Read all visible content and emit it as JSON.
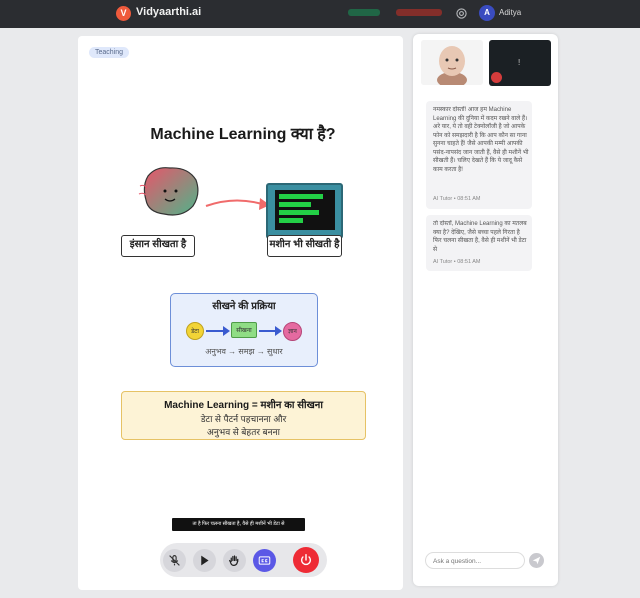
{
  "header": {
    "logo_letter": "V",
    "brand": "Vidyaarthi.ai",
    "user_initial": "A",
    "user_name": "Aditya"
  },
  "board": {
    "tag": "Teaching",
    "title": "Machine Learning क्या है?",
    "human_label": "इंसान सीखता है",
    "machine_label": "मशीन भी सीखती है",
    "process": {
      "title": "सीखने की प्रक्रिया",
      "steps": [
        "डेटा",
        "सीखना",
        "ज्ञान"
      ],
      "flow": "अनुभव → समझ → सुधार"
    },
    "summary": {
      "title": "Machine Learning = मशीन का सीखना",
      "line1": "डेटा से पैटर्न पहचानना और",
      "line2": "अनुभव से बेहतर बनना"
    },
    "caption": "ता है फिर चलना सीखता है, वैसे ही मशीनें भी डेटा से"
  },
  "controls": [
    "mic-off-icon",
    "play-icon",
    "hand-icon",
    "captions-icon",
    "power-icon"
  ],
  "colors": {
    "brand": "#ef5a3c",
    "accent_blue": "#5b58e6",
    "end_call_red": "#ee2b35",
    "screen_green": "#23d046"
  },
  "chat": {
    "messages": [
      {
        "text": "नमस्कार दोस्तों! आज हम Machine Learning की दुनिया में कदम रखने वाले हैं। अरे यार, ये तो वही टेक्नोलॉजी है जो आपके फोन को समझदारी है कि आप कौन सा गाना सुनना चाहते हैं! जैसे आपकी मम्मी आपकी पसंद-नापसंद जान जाती हैं, वैसे ही मशीनें भी सीखती हैं। चलिए देखते हैं कि ये जादू कैसे काम करता है!",
        "sender": "AI Tutor",
        "time": "08:51 AM"
      },
      {
        "text": "तो दोस्तों, Machine Learning का मतलब क्या है? देखिए, जैसे बच्चा पहले गिरता है फिर चलना सीखता है, वैसे ही मशीनें भी डेटा से",
        "sender": "AI Tutor",
        "time": "08:51 AM"
      }
    ],
    "input_placeholder": "Ask a question..."
  }
}
